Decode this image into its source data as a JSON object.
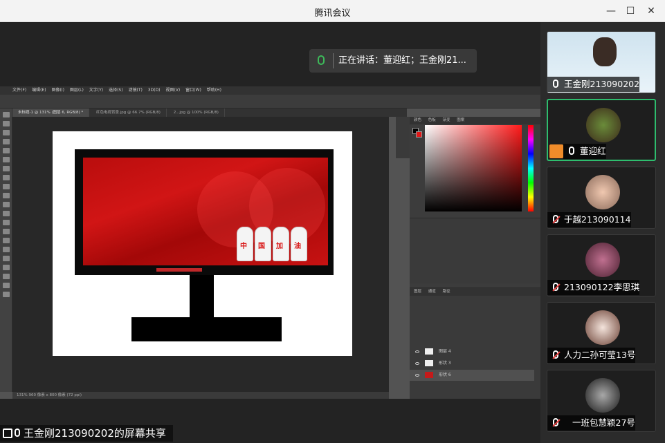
{
  "window": {
    "title": "腾讯会议",
    "minimize_icon": "minimize-icon",
    "maximize_icon": "maximize-icon",
    "close_icon": "close-icon"
  },
  "speaking": {
    "text": "正在讲话：董迎红；王金刚21..."
  },
  "photoshop": {
    "menu": [
      "文件(F)",
      "编辑(E)",
      "图像(I)",
      "图层(L)",
      "文字(Y)",
      "选择(S)",
      "滤镜(T)",
      "3D(D)",
      "视图(V)",
      "窗口(W)",
      "帮助(H)"
    ],
    "tabs": [
      "未标题-1 @ 131% (图层 6, RGB/8) *",
      "红色电视背景.jpg @ 66.7% (RGB/8)",
      "2...jpg @ 100% (RGB/8)"
    ],
    "status": "131%   960 像素 x 800 像素 (72 ppi)",
    "panel_tabs": [
      "颜色",
      "色板",
      "渐变",
      "图案"
    ],
    "layers_tabs": [
      "图层",
      "通道",
      "路径"
    ],
    "layers": [
      "图层 4",
      "形状 3",
      "形状 6"
    ],
    "slogan": [
      "中",
      "国",
      "加",
      "油"
    ]
  },
  "share": {
    "label": "王金刚213090202的屏幕共享"
  },
  "participants": [
    {
      "name": "王金刚213090202",
      "muted": false,
      "active": false
    },
    {
      "name": "董迎红",
      "muted": false,
      "active": true,
      "host": true
    },
    {
      "name": "于越213090114",
      "muted": true,
      "active": false
    },
    {
      "name": "213090122李思琪",
      "muted": true,
      "active": false
    },
    {
      "name": "人力二孙可莹13号",
      "muted": true,
      "active": false
    },
    {
      "name": "一班包慧颖27号",
      "muted": true,
      "active": false
    }
  ],
  "colors": {
    "accent": "#2ebd6e",
    "host": "#f08c2a",
    "muted": "#e84040"
  }
}
